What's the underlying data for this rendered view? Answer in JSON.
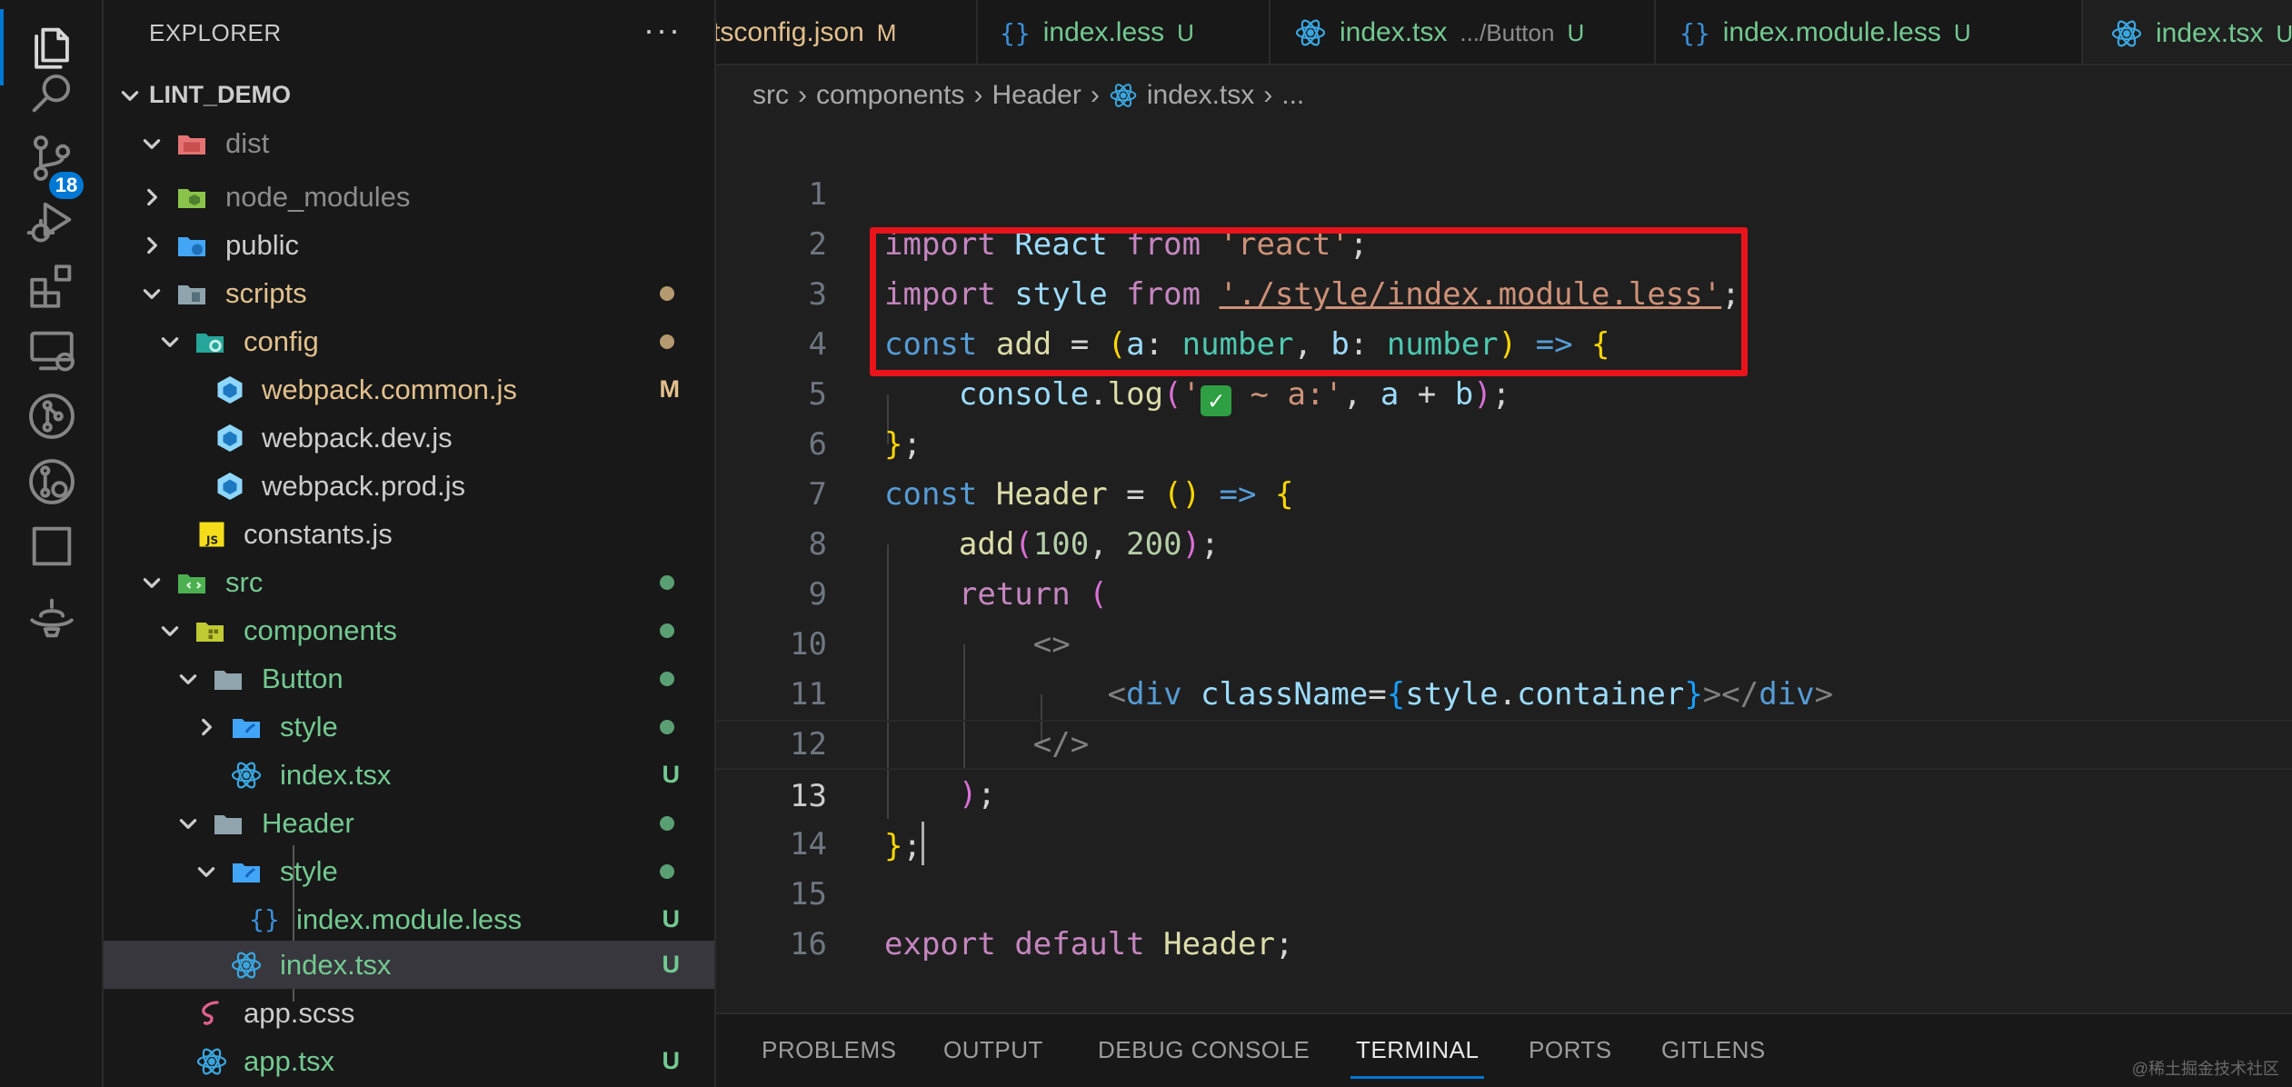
{
  "explorer": {
    "title": "EXPLORER",
    "more": "···",
    "project": "LINT_DEMO",
    "items": [
      {
        "label": "dist",
        "status": ""
      },
      {
        "label": "node_modules",
        "status": ""
      },
      {
        "label": "public",
        "status": ""
      },
      {
        "label": "scripts",
        "status": ""
      },
      {
        "label": "config",
        "status": ""
      },
      {
        "label": "webpack.common.js",
        "status": "M"
      },
      {
        "label": "webpack.dev.js",
        "status": ""
      },
      {
        "label": "webpack.prod.js",
        "status": ""
      },
      {
        "label": "constants.js",
        "status": ""
      },
      {
        "label": "src",
        "status": ""
      },
      {
        "label": "components",
        "status": ""
      },
      {
        "label": "Button",
        "status": ""
      },
      {
        "label": "style",
        "status": ""
      },
      {
        "label": "index.tsx",
        "status": "U"
      },
      {
        "label": "Header",
        "status": ""
      },
      {
        "label": "style",
        "status": ""
      },
      {
        "label": "index.module.less",
        "status": "U"
      },
      {
        "label": "index.tsx",
        "status": "U"
      },
      {
        "label": "app.scss",
        "status": ""
      },
      {
        "label": "app.tsx",
        "status": "U"
      }
    ]
  },
  "activity": {
    "source_control_badge": "18"
  },
  "tabs": [
    {
      "label": "tsconfig.json",
      "sub": "",
      "status": "M"
    },
    {
      "label": "index.less",
      "sub": "",
      "status": "U"
    },
    {
      "label": "index.tsx",
      "sub": ".../Button",
      "status": "U"
    },
    {
      "label": "index.module.less",
      "sub": "",
      "status": "U"
    },
    {
      "label": "index.tsx",
      "sub": "",
      "status": "U"
    }
  ],
  "breadcrumb": [
    "src",
    "components",
    "Header",
    "index.tsx",
    "..."
  ],
  "code": {
    "line_numbers": [
      "1",
      "2",
      "3",
      "4",
      "5",
      "6",
      "7",
      "8",
      "9",
      "10",
      "11",
      "12",
      "13",
      "14",
      "15",
      "16"
    ],
    "t": {
      "import": "import",
      "React": "React",
      "from": "from",
      "react_str": "'react'",
      "semi": ";",
      "style": "style",
      "less_path": "'./style/index.module.less'",
      "const": "const",
      "add": "add",
      "eq": " = ",
      "po": "(",
      "a": "a",
      "colon": ": ",
      "number": "number",
      "comma": ", ",
      "b": "b",
      "pc": ")",
      "arrow": " => ",
      "bo": "{",
      "console": "console",
      "dot": ".",
      "log": "log",
      "q1": "'",
      "log_str_rest": " ~ a:'",
      "plus": " + ",
      "bc": "}",
      "Header": "Header",
      "n100": "100",
      "n200": "200",
      "return": "return",
      "frag_open": "<>",
      "lt": "<",
      "div": "div",
      "className": "className",
      "eqs": "=",
      "container": "container",
      "gt": ">",
      "close_div_open": "</",
      "frag_close": "</>",
      "export": "export",
      "default": "default"
    }
  },
  "panel": {
    "tabs": [
      "PROBLEMS",
      "OUTPUT",
      "DEBUG CONSOLE",
      "TERMINAL",
      "PORTS",
      "GITLENS"
    ]
  },
  "watermark": "@稀土掘金技术社区",
  "colors": {
    "accent": "#0078d4",
    "highlight_box": "#e8131b",
    "untracked": "#73c991",
    "modified": "#e2c08d"
  }
}
